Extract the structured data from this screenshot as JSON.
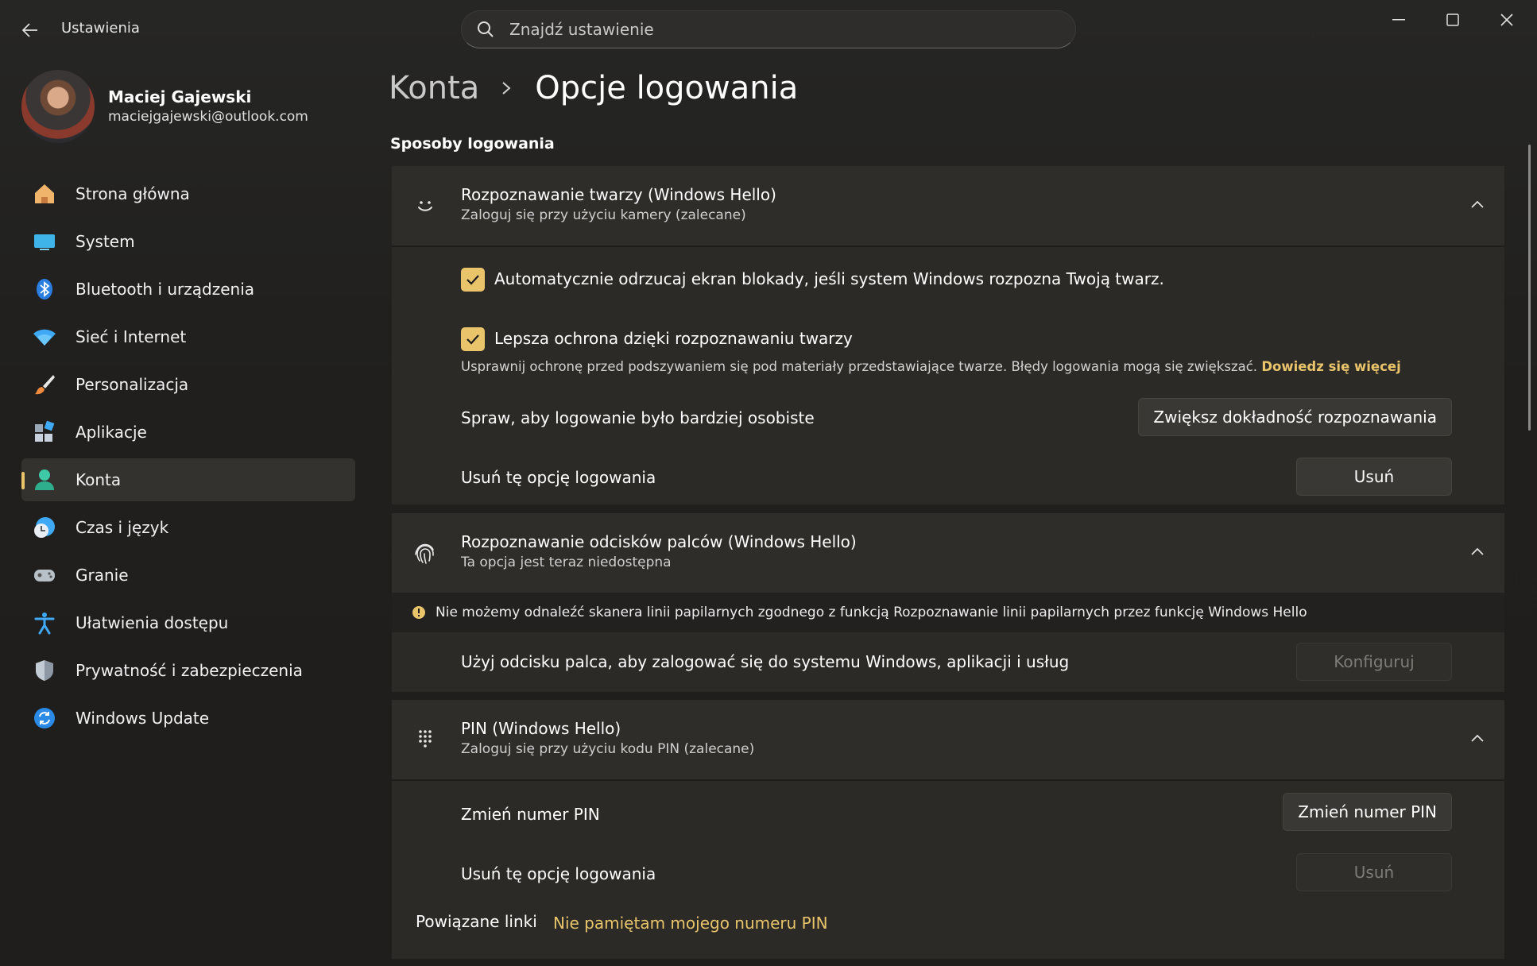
{
  "app": {
    "title": "Ustawienia"
  },
  "search": {
    "placeholder": "Znajdź ustawienie"
  },
  "user": {
    "name": "Maciej Gajewski",
    "email": "maciejgajewski@outlook.com"
  },
  "nav": [
    {
      "label": "Strona główna",
      "icon": "home-icon"
    },
    {
      "label": "System",
      "icon": "system-icon"
    },
    {
      "label": "Bluetooth i urządzenia",
      "icon": "bluetooth-icon"
    },
    {
      "label": "Sieć i Internet",
      "icon": "wifi-icon"
    },
    {
      "label": "Personalizacja",
      "icon": "brush-icon"
    },
    {
      "label": "Aplikacje",
      "icon": "apps-icon"
    },
    {
      "label": "Konta",
      "icon": "account-icon",
      "active": true
    },
    {
      "label": "Czas i język",
      "icon": "time-language-icon"
    },
    {
      "label": "Granie",
      "icon": "gaming-icon"
    },
    {
      "label": "Ułatwienia dostępu",
      "icon": "accessibility-icon"
    },
    {
      "label": "Prywatność i zabezpieczenia",
      "icon": "shield-icon"
    },
    {
      "label": "Windows Update",
      "icon": "update-icon"
    }
  ],
  "breadcrumb": {
    "parent": "Konta",
    "current": "Opcje logowania"
  },
  "section": {
    "title": "Sposoby logowania"
  },
  "face": {
    "title": "Rozpoznawanie twarzy (Windows Hello)",
    "subtitle": "Zaloguj się przy użyciu kamery (zalecane)",
    "auto_dismiss_label": "Automatycznie odrzucaj ekran blokady, jeśli system Windows rozpozna Twoją twarz.",
    "enhanced_label": "Lepsza ochrona dzięki rozpoznawaniu twarzy",
    "enhanced_hint": "Usprawnij ochronę przed podszywaniem się pod materiały przedstawiające twarze. Błędy logowania mogą się zwiększać.",
    "learn_more": "Dowiedz się więcej",
    "personal_label": "Spraw, aby logowanie było bardziej osobiste",
    "improve_button": "Zwiększ dokładność rozpoznawania",
    "remove_label": "Usuń tę opcję logowania",
    "remove_button": "Usuń"
  },
  "fingerprint": {
    "title": "Rozpoznawanie odcisków palców (Windows Hello)",
    "subtitle": "Ta opcja jest teraz niedostępna",
    "warning": "Nie możemy odnaleźć skanera linii papilarnych zgodnego z funkcją Rozpoznawanie linii papilarnych przez funkcję Windows Hello",
    "use_label": "Użyj odcisku palca, aby zalogować się do systemu Windows, aplikacji i usług",
    "configure_button": "Konfiguruj"
  },
  "pin": {
    "title": "PIN (Windows Hello)",
    "subtitle": "Zaloguj się przy użyciu kodu PIN (zalecane)",
    "change_label": "Zmień numer PIN",
    "change_button": "Zmień numer PIN",
    "remove_label": "Usuń tę opcję logowania",
    "remove_button": "Usuń",
    "related_label": "Powiązane linki",
    "forgot_link": "Nie pamiętam mojego numeru PIN"
  },
  "colors": {
    "accent": "#e9c46a",
    "background": "#202020"
  }
}
